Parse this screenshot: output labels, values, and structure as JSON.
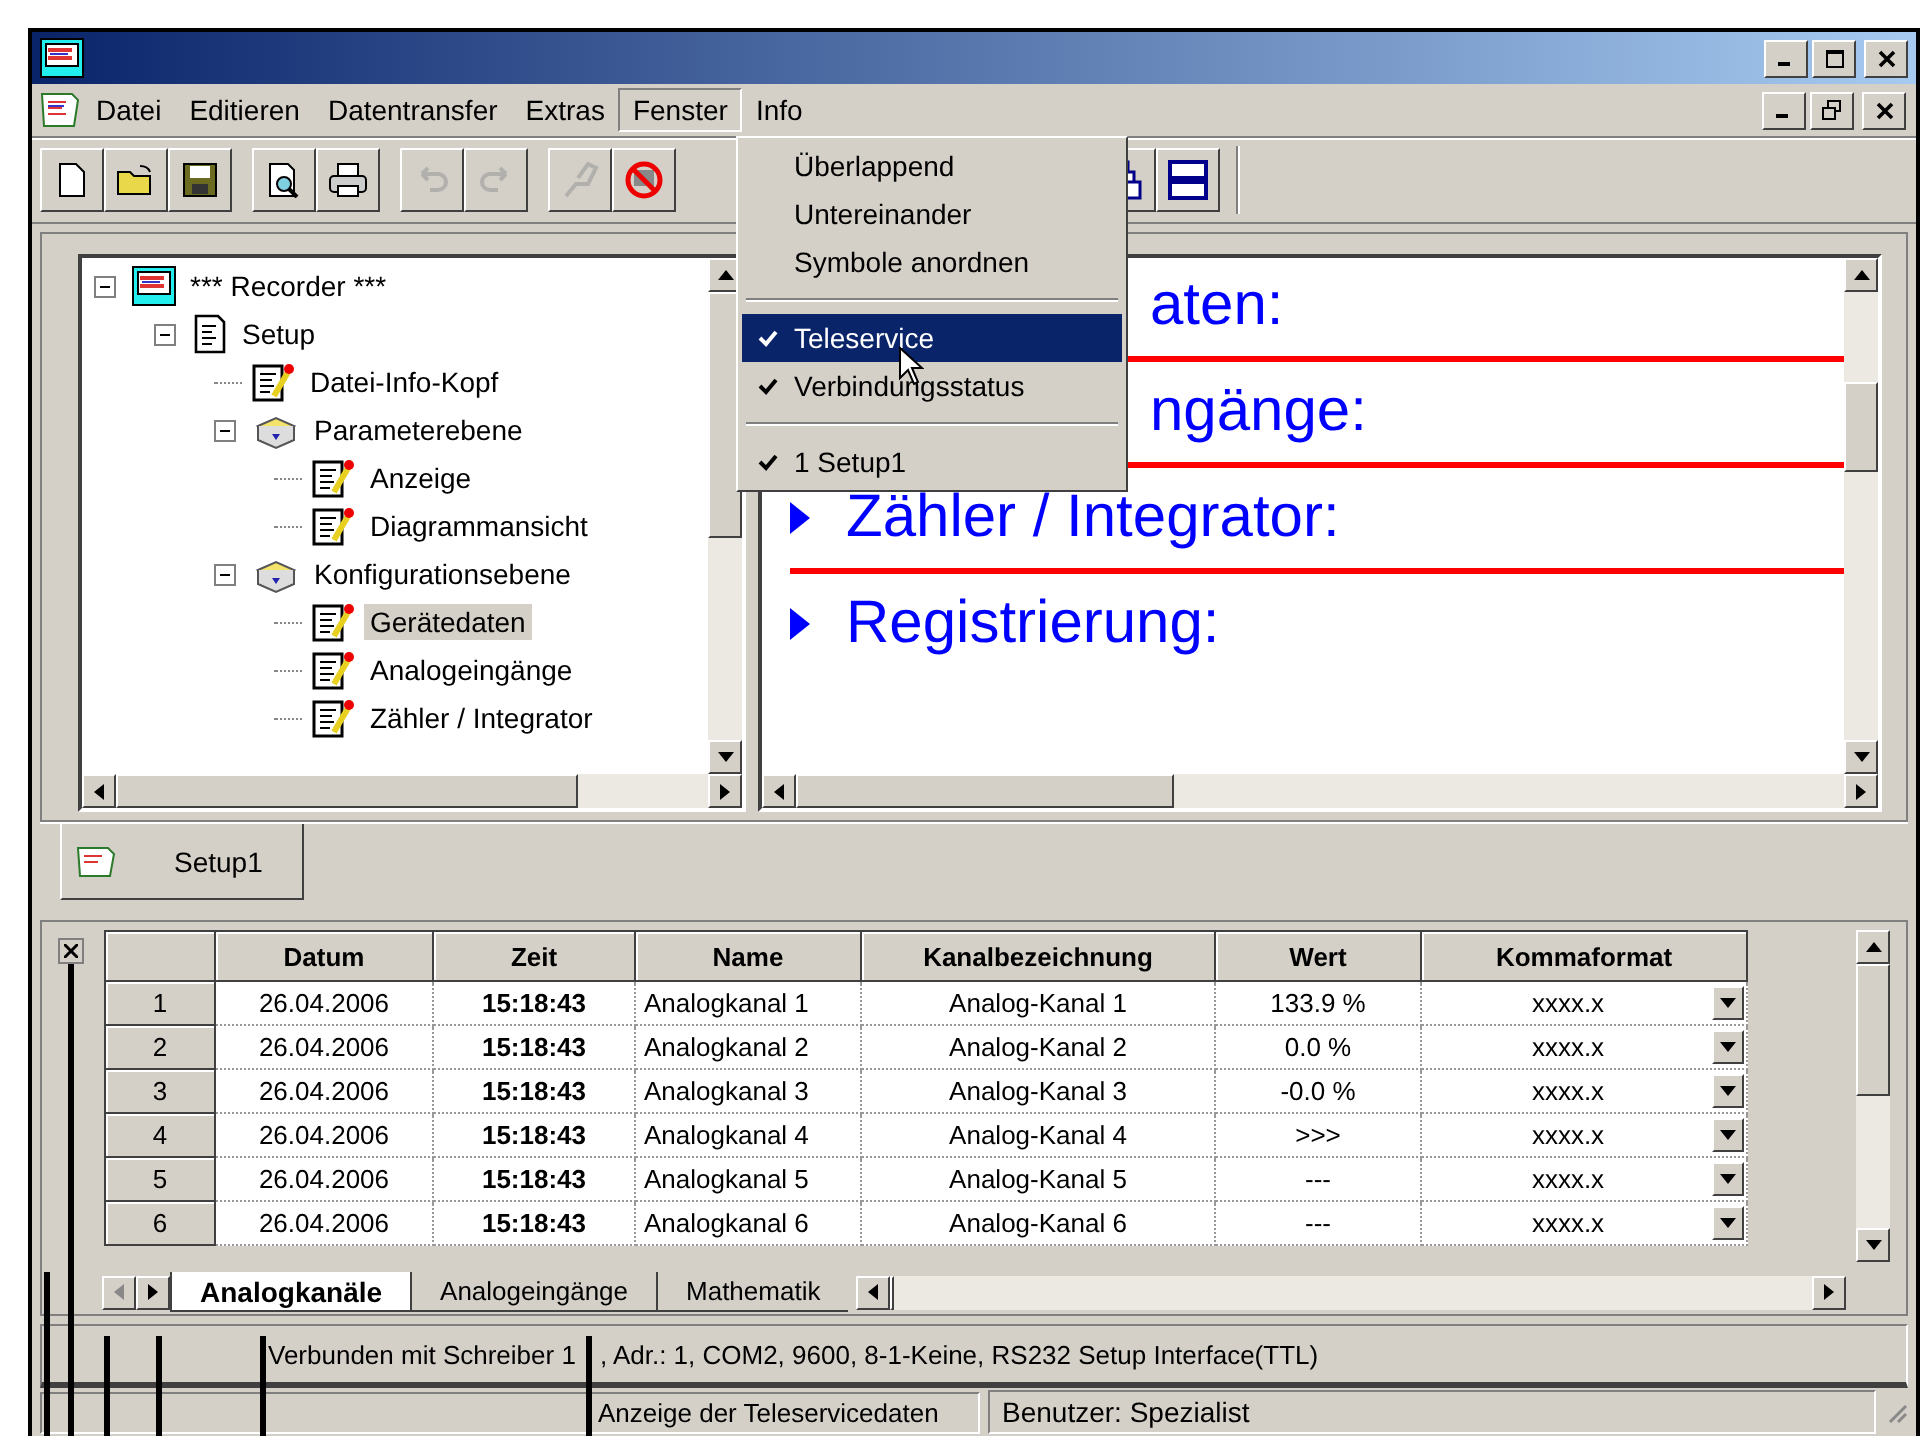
{
  "menu_bar": {
    "items": [
      {
        "label": "Datei",
        "selected": false
      },
      {
        "label": "Editieren",
        "selected": false
      },
      {
        "label": "Datentransfer",
        "selected": false
      },
      {
        "label": "Extras",
        "selected": false
      },
      {
        "label": "Fenster",
        "selected": true
      },
      {
        "label": "Info",
        "selected": false
      }
    ]
  },
  "toolbar": [
    {
      "kind": "new",
      "disabled": false
    },
    {
      "kind": "open",
      "disabled": false
    },
    {
      "kind": "save",
      "disabled": false
    },
    {
      "kind": "gap"
    },
    {
      "kind": "preview",
      "disabled": false
    },
    {
      "kind": "print",
      "disabled": false
    },
    {
      "kind": "gap"
    },
    {
      "kind": "undo",
      "disabled": true
    },
    {
      "kind": "redo",
      "disabled": true
    },
    {
      "kind": "gap"
    },
    {
      "kind": "connect",
      "disabled": true
    },
    {
      "kind": "disconnect",
      "disabled": false
    },
    {
      "kind": "menu-gap"
    },
    {
      "kind": "cascade",
      "disabled": false
    },
    {
      "kind": "tile",
      "disabled": false
    }
  ],
  "fenster_menu": [
    {
      "kind": "item",
      "label": "Überlappend",
      "checked": false,
      "selected": false
    },
    {
      "kind": "item",
      "label": "Untereinander",
      "checked": false,
      "selected": false
    },
    {
      "kind": "item",
      "label": "Symbole anordnen",
      "checked": false,
      "selected": false
    },
    {
      "kind": "separator"
    },
    {
      "kind": "item",
      "label": "Teleservice",
      "checked": true,
      "selected": true
    },
    {
      "kind": "item",
      "label": "Verbindungsstatus",
      "checked": true,
      "selected": false
    },
    {
      "kind": "separator"
    },
    {
      "kind": "item",
      "label": "1 Setup1",
      "checked": true,
      "selected": false
    }
  ],
  "tree": [
    {
      "label": "*** Recorder ***",
      "kind": "recorder",
      "selected": false,
      "expanded": true,
      "children": [
        {
          "label": "Setup",
          "kind": "setup",
          "selected": false,
          "expanded": true,
          "children": [
            {
              "label": "Datei-Info-Kopf",
              "kind": "page",
              "selected": false
            },
            {
              "label": "Parameterebene",
              "kind": "folder",
              "selected": false,
              "expanded": true,
              "children": [
                {
                  "label": "Anzeige",
                  "kind": "page",
                  "selected": false
                },
                {
                  "label": "Diagrammansicht",
                  "kind": "page",
                  "selected": false
                }
              ]
            },
            {
              "label": "Konfigurationsebene",
              "kind": "folder",
              "selected": false,
              "expanded": true,
              "children": [
                {
                  "label": "Gerätedaten",
                  "kind": "page",
                  "selected": true
                },
                {
                  "label": "Analogeingänge",
                  "kind": "page",
                  "selected": false
                },
                {
                  "label": "Zähler / Integrator",
                  "kind": "page",
                  "selected": false
                }
              ]
            }
          ]
        }
      ]
    }
  ],
  "content_sections": [
    {
      "label": "aten:",
      "marker": false
    },
    {
      "label": "ngänge:",
      "marker": false
    },
    {
      "label": "Zähler / Integrator:",
      "marker": true
    },
    {
      "label": "Registrierung:",
      "marker": true
    }
  ],
  "document_tabs": [
    {
      "label": "Setup1",
      "selected": true
    }
  ],
  "table": {
    "columns": [
      "Datum",
      "Zeit",
      "Name",
      "Kanalbezeichnung",
      "Wert",
      "Kommaformat"
    ],
    "rows": [
      {
        "number": "1",
        "cells": [
          "26.04.2006",
          "15:18:43",
          "Analogkanal 1",
          "Analog-Kanal 1",
          "133.9 %",
          "xxxx.x"
        ]
      },
      {
        "number": "2",
        "cells": [
          "26.04.2006",
          "15:18:43",
          "Analogkanal 2",
          "Analog-Kanal 2",
          "0.0 %",
          "xxxx.x"
        ]
      },
      {
        "number": "3",
        "cells": [
          "26.04.2006",
          "15:18:43",
          "Analogkanal 3",
          "Analog-Kanal 3",
          "-0.0 %",
          "xxxx.x"
        ]
      },
      {
        "number": "4",
        "cells": [
          "26.04.2006",
          "15:18:43",
          "Analogkanal 4",
          "Analog-Kanal 4",
          ">>>",
          "xxxx.x"
        ]
      },
      {
        "number": "5",
        "cells": [
          "26.04.2006",
          "15:18:43",
          "Analogkanal 5",
          "Analog-Kanal 5",
          "---",
          "xxxx.x"
        ]
      },
      {
        "number": "6",
        "cells": [
          "26.04.2006",
          "15:18:43",
          "Analogkanal 6",
          "Analog-Kanal 6",
          "---",
          "xxxx.x"
        ]
      }
    ]
  },
  "sheet_tabs": [
    {
      "label": "Analogkanäle",
      "selected": true
    },
    {
      "label": "Analogeingänge",
      "selected": false
    },
    {
      "label": "Mathematik",
      "selected": false
    }
  ],
  "status_bar": {
    "connection": [
      "Verbunden mit Schreiber 1",
      ", Adr.: 1, COM2, 9600, 8-1-Keine, RS232 Setup Interface(TTL)"
    ],
    "message": "Anzeige der Teleservicedaten",
    "user": "Benutzer: Spezialist"
  }
}
